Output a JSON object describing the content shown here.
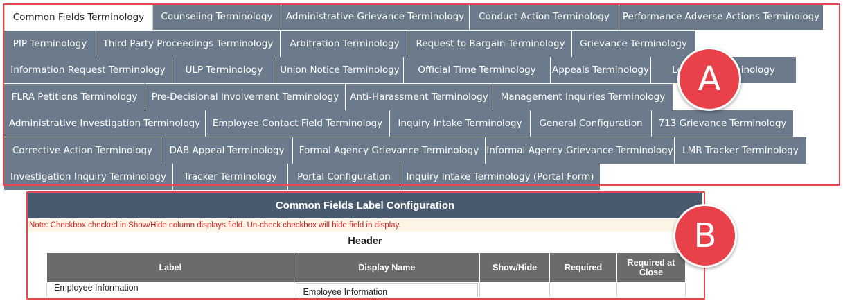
{
  "tab_rows": [
    [
      {
        "label": "Common Fields Terminology",
        "active": true
      },
      {
        "label": "Counseling Terminology"
      },
      {
        "label": "Administrative Grievance Terminology"
      },
      {
        "label": "Conduct Action Terminology"
      },
      {
        "label": "Performance Adverse Actions Terminology"
      }
    ],
    [
      {
        "label": "PIP Terminology"
      },
      {
        "label": "Third Party Proceedings Terminology"
      },
      {
        "label": "Arbitration Terminology"
      },
      {
        "label": "Request to Bargain Terminology"
      },
      {
        "label": "Grievance Terminology"
      }
    ],
    [
      {
        "label": "Information Request Terminology"
      },
      {
        "label": "ULP Terminology"
      },
      {
        "label": "Union Notice Terminology"
      },
      {
        "label": "Official Time Terminology"
      },
      {
        "label": "Appeals Terminology"
      },
      {
        "label": "Le...ation Terminology"
      }
    ],
    [
      {
        "label": "FLRA Petitions Terminology"
      },
      {
        "label": "Pre-Decisional Involvement Terminology"
      },
      {
        "label": "Anti-Harassment Terminology"
      },
      {
        "label": "Management Inquiries Terminology"
      }
    ],
    [
      {
        "label": "Administrative Investigation Terminology"
      },
      {
        "label": "Employee Contact Field Terminology"
      },
      {
        "label": "Inquiry Intake Terminology"
      },
      {
        "label": "General Configuration"
      },
      {
        "label": "713 Grievance Terminology"
      }
    ],
    [
      {
        "label": "Corrective Action Terminology"
      },
      {
        "label": "DAB Appeal Terminology"
      },
      {
        "label": "Formal Agency Grievance Terminology"
      },
      {
        "label": "Informal Agency Grievance Terminology"
      },
      {
        "label": "LMR Tracker Terminology"
      }
    ],
    [
      {
        "label": "Investigation Inquiry Terminology"
      },
      {
        "label": "Tracker Terminology"
      },
      {
        "label": "Portal Configuration"
      },
      {
        "label": "Inquiry Intake Terminology (Portal Form)"
      }
    ]
  ],
  "callouts": {
    "a": "A",
    "b": "B"
  },
  "panel": {
    "title": "Common Fields Label Configuration",
    "note": "Note: Checkbox checked in Show/Hide column displays field. Un-check checkbox will hide field in display.",
    "section": "Header",
    "columns": [
      "Label",
      "Display Name",
      "Show/Hide",
      "Required",
      "Required at Close"
    ],
    "rows": [
      {
        "label": "Employee Information",
        "display_name": "Employee Information"
      }
    ]
  },
  "colors": {
    "tab_bg": "#6b7b8c",
    "panel_header_bg": "#4a5a6e",
    "outline": "#e2474b",
    "note_text": "#d21f24"
  }
}
